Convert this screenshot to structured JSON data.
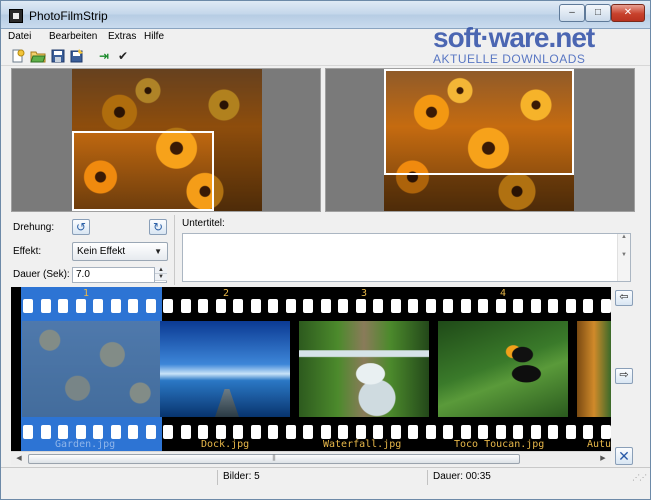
{
  "window": {
    "title": "PhotoFilmStrip",
    "min_symbol": "–",
    "max_symbol": "□",
    "close_symbol": "✕"
  },
  "watermark": {
    "line1": "soft·ware.net",
    "line2": "AKTUELLE DOWNLOADS"
  },
  "menu": {
    "items": [
      "Datei",
      "Bearbeiten",
      "Extras",
      "Hilfe"
    ]
  },
  "toolbar": {
    "icons": [
      "new-project-icon",
      "open-project-icon",
      "save-icon",
      "save-as-icon",
      "render-icon",
      "check-icon"
    ],
    "render_symbol": "⇥",
    "check_symbol": "✔"
  },
  "controls": {
    "rotation_label": "Drehung:",
    "rotate_left_symbol": "↺",
    "rotate_right_symbol": "↻",
    "effect_label": "Effekt:",
    "effect_value": "Kein Effekt",
    "duration_label": "Dauer (Sek):",
    "duration_value": "7.0",
    "subtitle_label": "Untertitel:",
    "subtitle_value": ""
  },
  "filmstrip": {
    "frames": [
      {
        "number": "1",
        "name": "Garden.jpg",
        "selected": true
      },
      {
        "number": "2",
        "name": "Dock.jpg",
        "selected": false
      },
      {
        "number": "3",
        "name": "Waterfall.jpg",
        "selected": false
      },
      {
        "number": "4",
        "name": "Toco Toucan.jpg",
        "selected": false
      },
      {
        "number": "",
        "name": "Autu",
        "selected": false
      }
    ]
  },
  "side_buttons": {
    "move_left_symbol": "⇦",
    "move_right_symbol": "⇨",
    "clear_symbol": "✕"
  },
  "scrollbar": {
    "grip": "⫼"
  },
  "status": {
    "images": "Bilder: 5",
    "duration": "Dauer: 00:35"
  },
  "colors": {
    "selection": "#2d74d4",
    "frame_text": "#e8b84a",
    "accent": "#2f4fa8"
  }
}
